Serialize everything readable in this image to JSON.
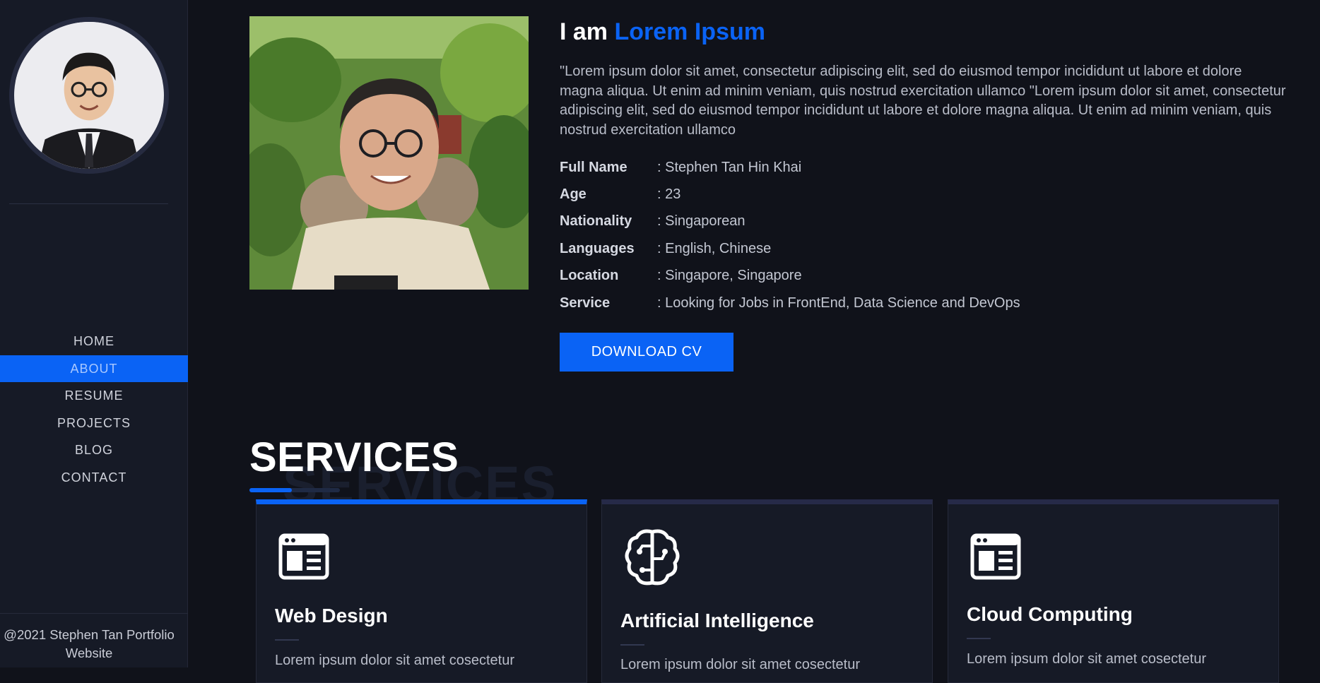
{
  "sidebar": {
    "nav": [
      "HOME",
      "ABOUT",
      "RESUME",
      "PROJECTS",
      "BLOG",
      "CONTACT"
    ],
    "active": "ABOUT",
    "footer": "@2021 Stephen Tan Portfolio Website"
  },
  "about": {
    "title_prefix": "I am",
    "title_name": "Lorem Ipsum",
    "description": "\"Lorem ipsum dolor sit amet, consectetur adipiscing elit, sed do eiusmod tempor incididunt ut labore et dolore magna aliqua. Ut enim ad minim veniam, quis nostrud exercitation ullamco \"Lorem ipsum dolor sit amet, consectetur adipiscing elit, sed do eiusmod tempor incididunt ut labore et dolore magna aliqua. Ut enim ad minim veniam, quis nostrud exercitation ullamco",
    "info": [
      {
        "key": "Full Name",
        "value": ": Stephen Tan Hin Khai"
      },
      {
        "key": "Age",
        "value": ": 23"
      },
      {
        "key": "Nationality",
        "value": ": Singaporean"
      },
      {
        "key": "Languages",
        "value": ": English, Chinese"
      },
      {
        "key": "Location",
        "value": ": Singapore, Singapore"
      },
      {
        "key": "Service",
        "value": ": Looking for Jobs in FrontEnd, Data Science and DevOps"
      }
    ],
    "download_label": "DOWNLOAD CV"
  },
  "services": {
    "title": "SERVICES",
    "ghost": "SERVICES",
    "cards": [
      {
        "title": "Web Design",
        "text": "Lorem ipsum dolor sit amet cosectetur",
        "icon": "browser-layout-icon"
      },
      {
        "title": "Artificial Intelligence",
        "text": "Lorem ipsum dolor sit amet cosectetur",
        "icon": "brain-circuit-icon"
      },
      {
        "title": "Cloud Computing",
        "text": "Lorem ipsum dolor sit amet cosectetur",
        "icon": "browser-layout-icon"
      }
    ]
  },
  "colors": {
    "accent": "#0a63f5",
    "background": "#10121a",
    "sidebar": "#161a26"
  }
}
